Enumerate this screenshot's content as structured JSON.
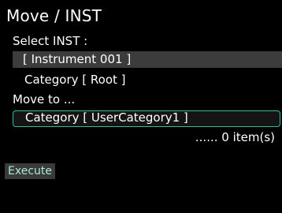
{
  "title": "Move / INST",
  "select_label": "Select INST :",
  "selected_instrument": "[ Instrument 001 ]",
  "source_category": "Category [ Root ]",
  "move_to_label": "Move to ...",
  "destination_category": "Category [ UserCategory1 ]",
  "item_count": "...... 0 item(s)",
  "execute_label": "Execute",
  "colors": {
    "background": "#000000",
    "text": "#ffffff",
    "selected_row": "#3c3c3c",
    "focus_border": "#2fbfa0",
    "execute_text": "#a8ecd8"
  }
}
